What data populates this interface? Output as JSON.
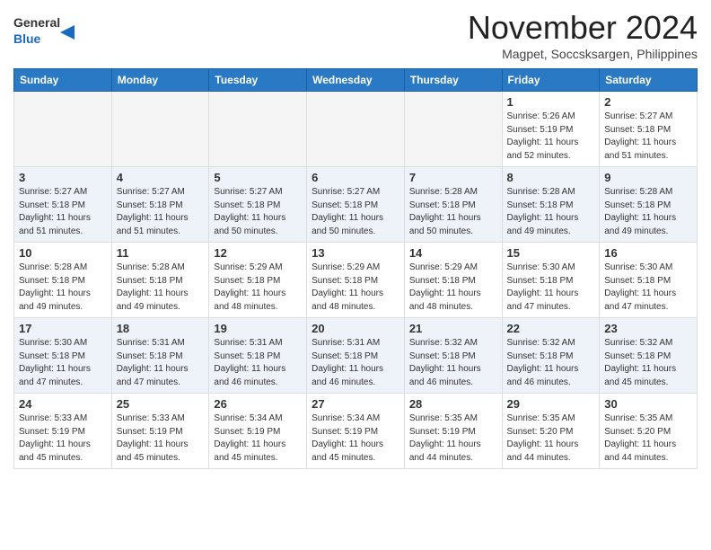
{
  "header": {
    "logo_general": "General",
    "logo_blue": "Blue",
    "month_title": "November 2024",
    "location": "Magpet, Soccsksargen, Philippines"
  },
  "weekdays": [
    "Sunday",
    "Monday",
    "Tuesday",
    "Wednesday",
    "Thursday",
    "Friday",
    "Saturday"
  ],
  "weeks": [
    [
      {
        "day": "",
        "info": ""
      },
      {
        "day": "",
        "info": ""
      },
      {
        "day": "",
        "info": ""
      },
      {
        "day": "",
        "info": ""
      },
      {
        "day": "",
        "info": ""
      },
      {
        "day": "1",
        "info": "Sunrise: 5:26 AM\nSunset: 5:19 PM\nDaylight: 11 hours\nand 52 minutes."
      },
      {
        "day": "2",
        "info": "Sunrise: 5:27 AM\nSunset: 5:18 PM\nDaylight: 11 hours\nand 51 minutes."
      }
    ],
    [
      {
        "day": "3",
        "info": "Sunrise: 5:27 AM\nSunset: 5:18 PM\nDaylight: 11 hours\nand 51 minutes."
      },
      {
        "day": "4",
        "info": "Sunrise: 5:27 AM\nSunset: 5:18 PM\nDaylight: 11 hours\nand 51 minutes."
      },
      {
        "day": "5",
        "info": "Sunrise: 5:27 AM\nSunset: 5:18 PM\nDaylight: 11 hours\nand 50 minutes."
      },
      {
        "day": "6",
        "info": "Sunrise: 5:27 AM\nSunset: 5:18 PM\nDaylight: 11 hours\nand 50 minutes."
      },
      {
        "day": "7",
        "info": "Sunrise: 5:28 AM\nSunset: 5:18 PM\nDaylight: 11 hours\nand 50 minutes."
      },
      {
        "day": "8",
        "info": "Sunrise: 5:28 AM\nSunset: 5:18 PM\nDaylight: 11 hours\nand 49 minutes."
      },
      {
        "day": "9",
        "info": "Sunrise: 5:28 AM\nSunset: 5:18 PM\nDaylight: 11 hours\nand 49 minutes."
      }
    ],
    [
      {
        "day": "10",
        "info": "Sunrise: 5:28 AM\nSunset: 5:18 PM\nDaylight: 11 hours\nand 49 minutes."
      },
      {
        "day": "11",
        "info": "Sunrise: 5:28 AM\nSunset: 5:18 PM\nDaylight: 11 hours\nand 49 minutes."
      },
      {
        "day": "12",
        "info": "Sunrise: 5:29 AM\nSunset: 5:18 PM\nDaylight: 11 hours\nand 48 minutes."
      },
      {
        "day": "13",
        "info": "Sunrise: 5:29 AM\nSunset: 5:18 PM\nDaylight: 11 hours\nand 48 minutes."
      },
      {
        "day": "14",
        "info": "Sunrise: 5:29 AM\nSunset: 5:18 PM\nDaylight: 11 hours\nand 48 minutes."
      },
      {
        "day": "15",
        "info": "Sunrise: 5:30 AM\nSunset: 5:18 PM\nDaylight: 11 hours\nand 47 minutes."
      },
      {
        "day": "16",
        "info": "Sunrise: 5:30 AM\nSunset: 5:18 PM\nDaylight: 11 hours\nand 47 minutes."
      }
    ],
    [
      {
        "day": "17",
        "info": "Sunrise: 5:30 AM\nSunset: 5:18 PM\nDaylight: 11 hours\nand 47 minutes."
      },
      {
        "day": "18",
        "info": "Sunrise: 5:31 AM\nSunset: 5:18 PM\nDaylight: 11 hours\nand 47 minutes."
      },
      {
        "day": "19",
        "info": "Sunrise: 5:31 AM\nSunset: 5:18 PM\nDaylight: 11 hours\nand 46 minutes."
      },
      {
        "day": "20",
        "info": "Sunrise: 5:31 AM\nSunset: 5:18 PM\nDaylight: 11 hours\nand 46 minutes."
      },
      {
        "day": "21",
        "info": "Sunrise: 5:32 AM\nSunset: 5:18 PM\nDaylight: 11 hours\nand 46 minutes."
      },
      {
        "day": "22",
        "info": "Sunrise: 5:32 AM\nSunset: 5:18 PM\nDaylight: 11 hours\nand 46 minutes."
      },
      {
        "day": "23",
        "info": "Sunrise: 5:32 AM\nSunset: 5:18 PM\nDaylight: 11 hours\nand 45 minutes."
      }
    ],
    [
      {
        "day": "24",
        "info": "Sunrise: 5:33 AM\nSunset: 5:19 PM\nDaylight: 11 hours\nand 45 minutes."
      },
      {
        "day": "25",
        "info": "Sunrise: 5:33 AM\nSunset: 5:19 PM\nDaylight: 11 hours\nand 45 minutes."
      },
      {
        "day": "26",
        "info": "Sunrise: 5:34 AM\nSunset: 5:19 PM\nDaylight: 11 hours\nand 45 minutes."
      },
      {
        "day": "27",
        "info": "Sunrise: 5:34 AM\nSunset: 5:19 PM\nDaylight: 11 hours\nand 45 minutes."
      },
      {
        "day": "28",
        "info": "Sunrise: 5:35 AM\nSunset: 5:19 PM\nDaylight: 11 hours\nand 44 minutes."
      },
      {
        "day": "29",
        "info": "Sunrise: 5:35 AM\nSunset: 5:20 PM\nDaylight: 11 hours\nand 44 minutes."
      },
      {
        "day": "30",
        "info": "Sunrise: 5:35 AM\nSunset: 5:20 PM\nDaylight: 11 hours\nand 44 minutes."
      }
    ]
  ]
}
